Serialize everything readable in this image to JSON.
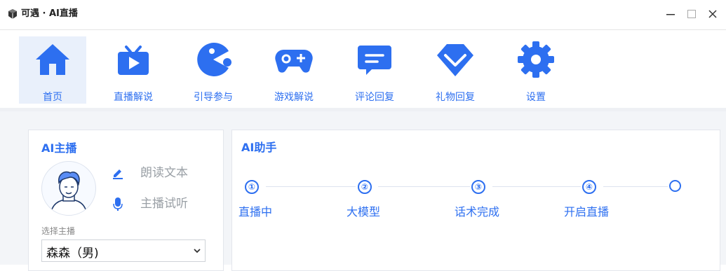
{
  "window": {
    "title": "可遇 · AI直播"
  },
  "toolbar": {
    "items": [
      {
        "label": "首页",
        "icon": "home-icon",
        "active": true
      },
      {
        "label": "直播解说",
        "icon": "tv-play-icon",
        "active": false
      },
      {
        "label": "引导参与",
        "icon": "pacman-icon",
        "active": false
      },
      {
        "label": "游戏解说",
        "icon": "gamepad-icon",
        "active": false
      },
      {
        "label": "评论回复",
        "icon": "chat-bubble-icon",
        "active": false
      },
      {
        "label": "礼物回复",
        "icon": "gift-chevron-icon",
        "active": false
      },
      {
        "label": "设置",
        "icon": "gear-icon",
        "active": false
      }
    ]
  },
  "anchor_panel": {
    "title": "AI主播",
    "read_text_label": "朗读文本",
    "preview_label": "主播试听",
    "select_label": "选择主播",
    "selected_anchor": "森森（男)"
  },
  "assistant_panel": {
    "title": "AI助手",
    "steps": [
      {
        "number": "①",
        "label": "直播中"
      },
      {
        "number": "②",
        "label": "大模型"
      },
      {
        "number": "③",
        "label": "话术完成"
      },
      {
        "number": "④",
        "label": "开启直播"
      },
      {
        "number": "",
        "label": ""
      }
    ]
  },
  "colors": {
    "accent": "#2d6ff0",
    "muted": "#9aa0a6",
    "active_bg": "#e9f0fb"
  }
}
